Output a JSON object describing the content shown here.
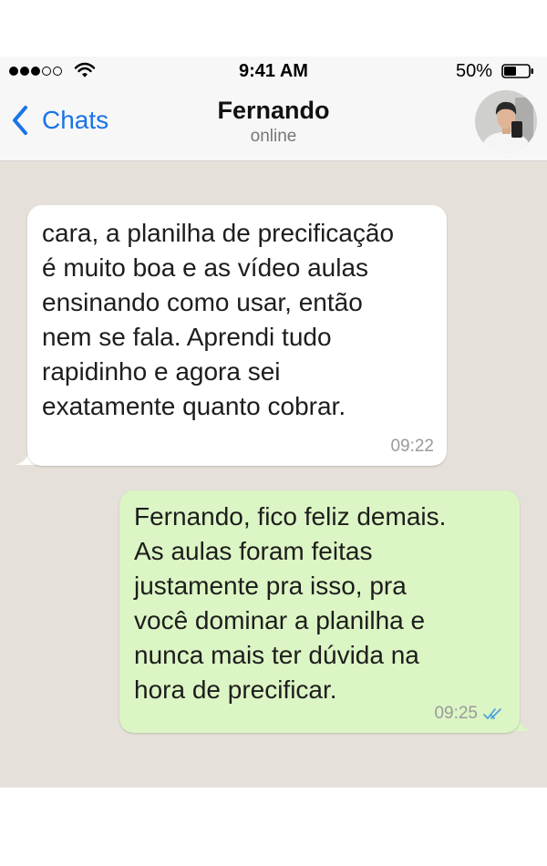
{
  "status_bar": {
    "time": "9:41 AM",
    "battery_percent": "50%",
    "battery_level": 0.5,
    "signal_bars": 3,
    "signal_total": 5,
    "icons": [
      "signal-dots-icon",
      "wifi-icon",
      "battery-icon"
    ]
  },
  "header": {
    "back_label": "Chats",
    "contact_name": "Fernando",
    "contact_status": "online",
    "icons": [
      "chevron-left-icon",
      "avatar"
    ]
  },
  "messages": [
    {
      "direction": "incoming",
      "lines": [
        "cara, a planilha de precificação",
        "é muito boa e as vídeo aulas",
        "ensinando como usar, então",
        "nem se fala. Aprendi tudo",
        "rapidinho e agora sei",
        "exatamente quanto cobrar."
      ],
      "time": "09:22"
    },
    {
      "direction": "outgoing",
      "lines": [
        "Fernando, fico feliz demais.",
        "As aulas foram feitas",
        "justamente pra isso, pra",
        "você dominar a planilha e",
        "nunca mais ter dúvida na",
        "hora de precificar."
      ],
      "time": "09:25",
      "status": "read",
      "status_icon": "double-check-icon"
    }
  ],
  "colors": {
    "accent": "#1a73e8",
    "chat_background": "#e5e1da",
    "incoming_bubble": "#ffffff",
    "outgoing_bubble": "#dcf5c4",
    "read_ticks": "#4fa3e0"
  }
}
